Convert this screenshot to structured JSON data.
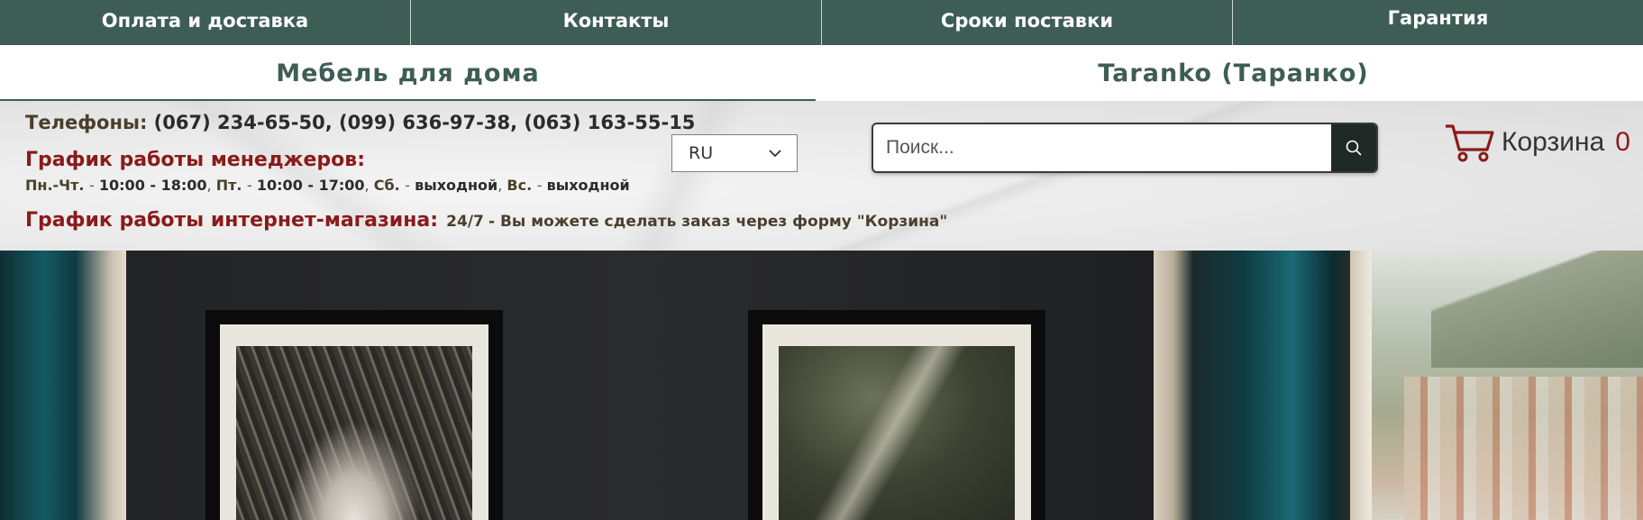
{
  "nav": {
    "items": [
      {
        "label": "Оплата и доставка"
      },
      {
        "label": "Контакты"
      },
      {
        "label": "Сроки поставки"
      },
      {
        "label": "Гарантия"
      }
    ]
  },
  "titles": {
    "left": "Мебель для дома",
    "right": "Taranko (Таранко)"
  },
  "contacts": {
    "phones_label": "Телефоны:",
    "phones": "(067) 234-65-50, (099) 636-97-38, (063) 163-55-15",
    "managers_title": "График работы менеджеров:",
    "schedule": {
      "mon_thu_label": "Пн.-Чт.",
      "mon_thu": "10:00 - 18:00",
      "fri_label": "Пт.",
      "fri": "10:00 - 17:00",
      "sat_label": "Сб.",
      "sat": "выходной",
      "sun_label": "Вс.",
      "sun": "выходной"
    },
    "shop_title": "График работы интернет-магазина:",
    "shop_hours": "24/7",
    "shop_note": "- Вы можете сделать заказ через форму \"Корзина\""
  },
  "language": {
    "selected": "RU"
  },
  "search": {
    "placeholder": "Поиск..."
  },
  "cart": {
    "label": "Корзина",
    "count": "0"
  },
  "colors": {
    "nav_bg": "#3d5d55",
    "accent_red": "#8b1a1a",
    "search_button": "#1f2a27"
  }
}
